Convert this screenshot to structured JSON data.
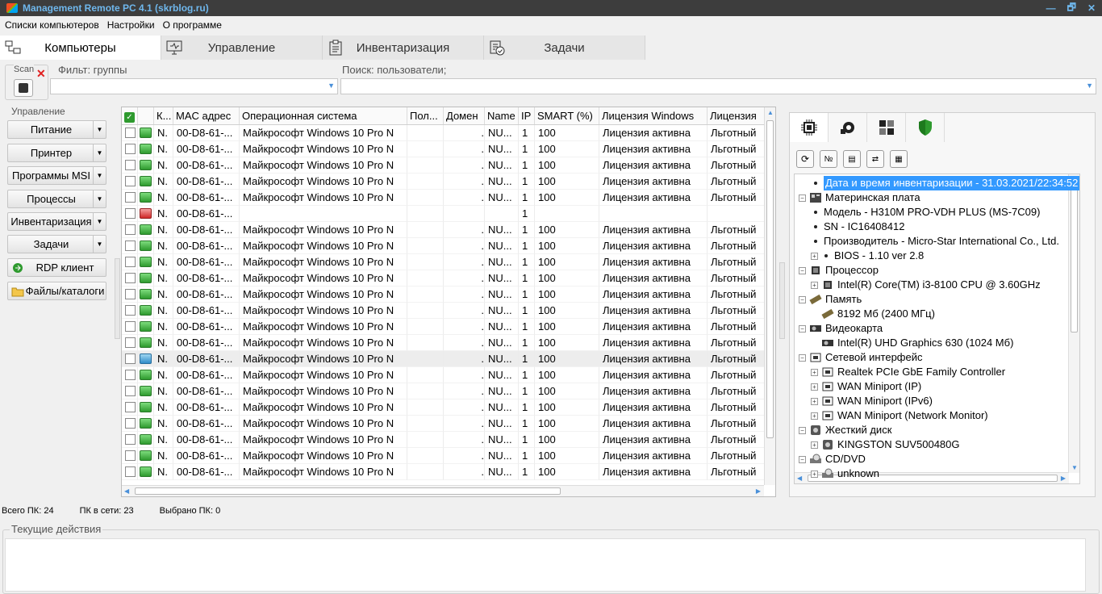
{
  "window": {
    "title": "Management Remote PC 4.1 (skrblog.ru)",
    "min": "—",
    "max": "🗗",
    "close": "✕"
  },
  "menu": [
    "Списки компьютеров",
    "Настройки",
    "О программе"
  ],
  "tabs": [
    "Компьютеры",
    "Управление",
    "Инвентаризация",
    "Задачи"
  ],
  "scan": {
    "label": "Scan"
  },
  "filter": {
    "label": "Фильт: группы",
    "value": ""
  },
  "search": {
    "label": "Поиск: пользователи;",
    "value": ""
  },
  "management": {
    "caption": "Управление",
    "buttons": [
      "Питание",
      "Принтер",
      "Программы MSI",
      "Процессы",
      "Инвентаризация",
      "Задачи",
      "RDP клиент",
      "Файлы/каталоги"
    ]
  },
  "grid": {
    "columns": [
      "К...",
      "MAC адрес",
      "Операционная система",
      "Пол...",
      "Домен",
      "Name",
      "IP",
      "SMART (%)",
      "Лицензия Windows",
      "Лицензия"
    ],
    "rows": [
      {
        "k": "N.",
        "mac": "00-D8-61-...",
        "os": "Майкрософт Windows 10 Pro N",
        "pol": "",
        "dom": ".",
        "name": "NU...",
        "ip": "1",
        "smart": "100",
        "lic": "Лицензия активна",
        "lic2": "Льготный",
        "state": "on"
      },
      {
        "k": "N.",
        "mac": "00-D8-61-...",
        "os": "Майкрософт Windows 10 Pro N",
        "pol": "",
        "dom": ".",
        "name": "NU...",
        "ip": "1",
        "smart": "100",
        "lic": "Лицензия активна",
        "lic2": "Льготный",
        "state": "on"
      },
      {
        "k": "N.",
        "mac": "00-D8-61-...",
        "os": "Майкрософт Windows 10 Pro N",
        "pol": "",
        "dom": ".",
        "name": "NU...",
        "ip": "1",
        "smart": "100",
        "lic": "Лицензия активна",
        "lic2": "Льготный",
        "state": "on"
      },
      {
        "k": "N.",
        "mac": "00-D8-61-...",
        "os": "Майкрософт Windows 10 Pro N",
        "pol": "",
        "dom": ".",
        "name": "NU...",
        "ip": "1",
        "smart": "100",
        "lic": "Лицензия активна",
        "lic2": "Льготный",
        "state": "on"
      },
      {
        "k": "N.",
        "mac": "00-D8-61-...",
        "os": "Майкрософт Windows 10 Pro N",
        "pol": "",
        "dom": ".",
        "name": "NU...",
        "ip": "1",
        "smart": "100",
        "lic": "Лицензия активна",
        "lic2": "Льготный",
        "state": "on"
      },
      {
        "k": "N.",
        "mac": "00-D8-61-...",
        "os": "",
        "pol": "",
        "dom": "",
        "name": "",
        "ip": "1",
        "smart": "",
        "lic": "",
        "lic2": "",
        "state": "off"
      },
      {
        "k": "N.",
        "mac": "00-D8-61-...",
        "os": "Майкрософт Windows 10 Pro N",
        "pol": "",
        "dom": ".",
        "name": "NU...",
        "ip": "1",
        "smart": "100",
        "lic": "Лицензия активна",
        "lic2": "Льготный",
        "state": "on"
      },
      {
        "k": "N.",
        "mac": "00-D8-61-...",
        "os": "Майкрософт Windows 10 Pro N",
        "pol": "",
        "dom": ".",
        "name": "NU...",
        "ip": "1",
        "smart": "100",
        "lic": "Лицензия активна",
        "lic2": "Льготный",
        "state": "on"
      },
      {
        "k": "N.",
        "mac": "00-D8-61-...",
        "os": "Майкрософт Windows 10 Pro N",
        "pol": "",
        "dom": ".",
        "name": "NU...",
        "ip": "1",
        "smart": "100",
        "lic": "Лицензия активна",
        "lic2": "Льготный",
        "state": "on"
      },
      {
        "k": "N.",
        "mac": "00-D8-61-...",
        "os": "Майкрософт Windows 10 Pro N",
        "pol": "",
        "dom": ".",
        "name": "NU...",
        "ip": "1",
        "smart": "100",
        "lic": "Лицензия активна",
        "lic2": "Льготный",
        "state": "on"
      },
      {
        "k": "N.",
        "mac": "00-D8-61-...",
        "os": "Майкрософт Windows 10 Pro N",
        "pol": "",
        "dom": ".",
        "name": "NU...",
        "ip": "1",
        "smart": "100",
        "lic": "Лицензия активна",
        "lic2": "Льготный",
        "state": "on"
      },
      {
        "k": "N.",
        "mac": "00-D8-61-...",
        "os": "Майкрософт Windows 10 Pro N",
        "pol": "",
        "dom": ".",
        "name": "NU...",
        "ip": "1",
        "smart": "100",
        "lic": "Лицензия активна",
        "lic2": "Льготный",
        "state": "on"
      },
      {
        "k": "N.",
        "mac": "00-D8-61-...",
        "os": "Майкрософт Windows 10 Pro N",
        "pol": "",
        "dom": ".",
        "name": "NU...",
        "ip": "1",
        "smart": "100",
        "lic": "Лицензия активна",
        "lic2": "Льготный",
        "state": "on"
      },
      {
        "k": "N.",
        "mac": "00-D8-61-...",
        "os": "Майкрософт Windows 10 Pro N",
        "pol": "",
        "dom": ".",
        "name": "NU...",
        "ip": "1",
        "smart": "100",
        "lic": "Лицензия активна",
        "lic2": "Льготный",
        "state": "on"
      },
      {
        "k": "N.",
        "mac": "00-D8-61-...",
        "os": "Майкрософт Windows 10 Pro N",
        "pol": "",
        "dom": ".",
        "name": "NU...",
        "ip": "1",
        "smart": "100",
        "lic": "Лицензия активна",
        "lic2": "Льготный",
        "state": "net"
      },
      {
        "k": "N.",
        "mac": "00-D8-61-...",
        "os": "Майкрософт Windows 10 Pro N",
        "pol": "",
        "dom": ".",
        "name": "NU...",
        "ip": "1",
        "smart": "100",
        "lic": "Лицензия активна",
        "lic2": "Льготный",
        "state": "on"
      },
      {
        "k": "N.",
        "mac": "00-D8-61-...",
        "os": "Майкрософт Windows 10 Pro N",
        "pol": "",
        "dom": ".",
        "name": "NU...",
        "ip": "1",
        "smart": "100",
        "lic": "Лицензия активна",
        "lic2": "Льготный",
        "state": "on"
      },
      {
        "k": "N.",
        "mac": "00-D8-61-...",
        "os": "Майкрософт Windows 10 Pro N",
        "pol": "",
        "dom": ".",
        "name": "NU...",
        "ip": "1",
        "smart": "100",
        "lic": "Лицензия активна",
        "lic2": "Льготный",
        "state": "on"
      },
      {
        "k": "N.",
        "mac": "00-D8-61-...",
        "os": "Майкрософт Windows 10 Pro N",
        "pol": "",
        "dom": ".",
        "name": "NU...",
        "ip": "1",
        "smart": "100",
        "lic": "Лицензия активна",
        "lic2": "Льготный",
        "state": "on"
      },
      {
        "k": "N.",
        "mac": "00-D8-61-...",
        "os": "Майкрософт Windows 10 Pro N",
        "pol": "",
        "dom": ".",
        "name": "NU...",
        "ip": "1",
        "smart": "100",
        "lic": "Лицензия активна",
        "lic2": "Льготный",
        "state": "on"
      },
      {
        "k": "N.",
        "mac": "00-D8-61-...",
        "os": "Майкрософт Windows 10 Pro N",
        "pol": "",
        "dom": ".",
        "name": "NU...",
        "ip": "1",
        "smart": "100",
        "lic": "Лицензия активна",
        "lic2": "Льготный",
        "state": "on"
      },
      {
        "k": "N.",
        "mac": "00-D8-61-...",
        "os": "Майкрософт Windows 10 Pro N",
        "pol": "",
        "dom": ".",
        "name": "NU...",
        "ip": "1",
        "smart": "100",
        "lic": "Лицензия активна",
        "lic2": "Льготный",
        "state": "on"
      }
    ]
  },
  "inventory": {
    "tree": [
      {
        "level": 1,
        "type": "leaf",
        "text": "Дата и время инвентаризации - 31.03.2021/22:34:52",
        "hl": true
      },
      {
        "level": 0,
        "type": "group",
        "text": "Материнская плата",
        "icon": "motherboard-icon"
      },
      {
        "level": 1,
        "type": "leaf",
        "text": "Модель - H310M PRO-VDH PLUS (MS-7C09)"
      },
      {
        "level": 1,
        "type": "leaf",
        "text": "SN - IC16408412"
      },
      {
        "level": 1,
        "type": "leaf",
        "text": "Производитель - Micro-Star International Co., Ltd."
      },
      {
        "level": 1,
        "type": "sub",
        "text": "BIOS - 1.10 ver 2.8"
      },
      {
        "level": 0,
        "type": "group",
        "text": "Процессор",
        "icon": "cpu-icon"
      },
      {
        "level": 1,
        "type": "subicon",
        "text": "Intel(R) Core(TM) i3-8100 CPU @ 3.60GHz",
        "icon": "cpu-icon"
      },
      {
        "level": 0,
        "type": "group",
        "text": "Память",
        "icon": "memory-icon"
      },
      {
        "level": 1,
        "type": "iconleaf",
        "text": "8192 Мб (2400 МГц)",
        "icon": "memory-icon"
      },
      {
        "level": 0,
        "type": "group",
        "text": "Видеокарта",
        "icon": "gpu-icon"
      },
      {
        "level": 1,
        "type": "iconleaf",
        "text": "Intel(R) UHD Graphics 630 (1024 Мб)",
        "icon": "gpu-icon"
      },
      {
        "level": 0,
        "type": "group",
        "text": "Сетевой интерфейс",
        "icon": "network-icon"
      },
      {
        "level": 1,
        "type": "subicon",
        "text": "Realtek PCIe GbE Family Controller",
        "icon": "network-icon"
      },
      {
        "level": 1,
        "type": "subicon",
        "text": "WAN Miniport (IP)",
        "icon": "network-icon"
      },
      {
        "level": 1,
        "type": "subicon",
        "text": "WAN Miniport (IPv6)",
        "icon": "network-icon"
      },
      {
        "level": 1,
        "type": "subicon",
        "text": "WAN Miniport (Network Monitor)",
        "icon": "network-icon"
      },
      {
        "level": 0,
        "type": "group",
        "text": "Жесткий диск",
        "icon": "disk-icon"
      },
      {
        "level": 1,
        "type": "subicon",
        "text": "KINGSTON SUV500480G",
        "icon": "disk-icon"
      },
      {
        "level": 0,
        "type": "group",
        "text": "CD/DVD",
        "icon": "cdrom-icon"
      },
      {
        "level": 1,
        "type": "subicon",
        "text": "unknown",
        "icon": "cdrom-icon"
      }
    ]
  },
  "status": {
    "total": "Всего ПК: 24",
    "online": "ПК в сети: 23",
    "selected": "Выбрано ПК: 0"
  },
  "actions": {
    "caption": "Текущие действия"
  }
}
